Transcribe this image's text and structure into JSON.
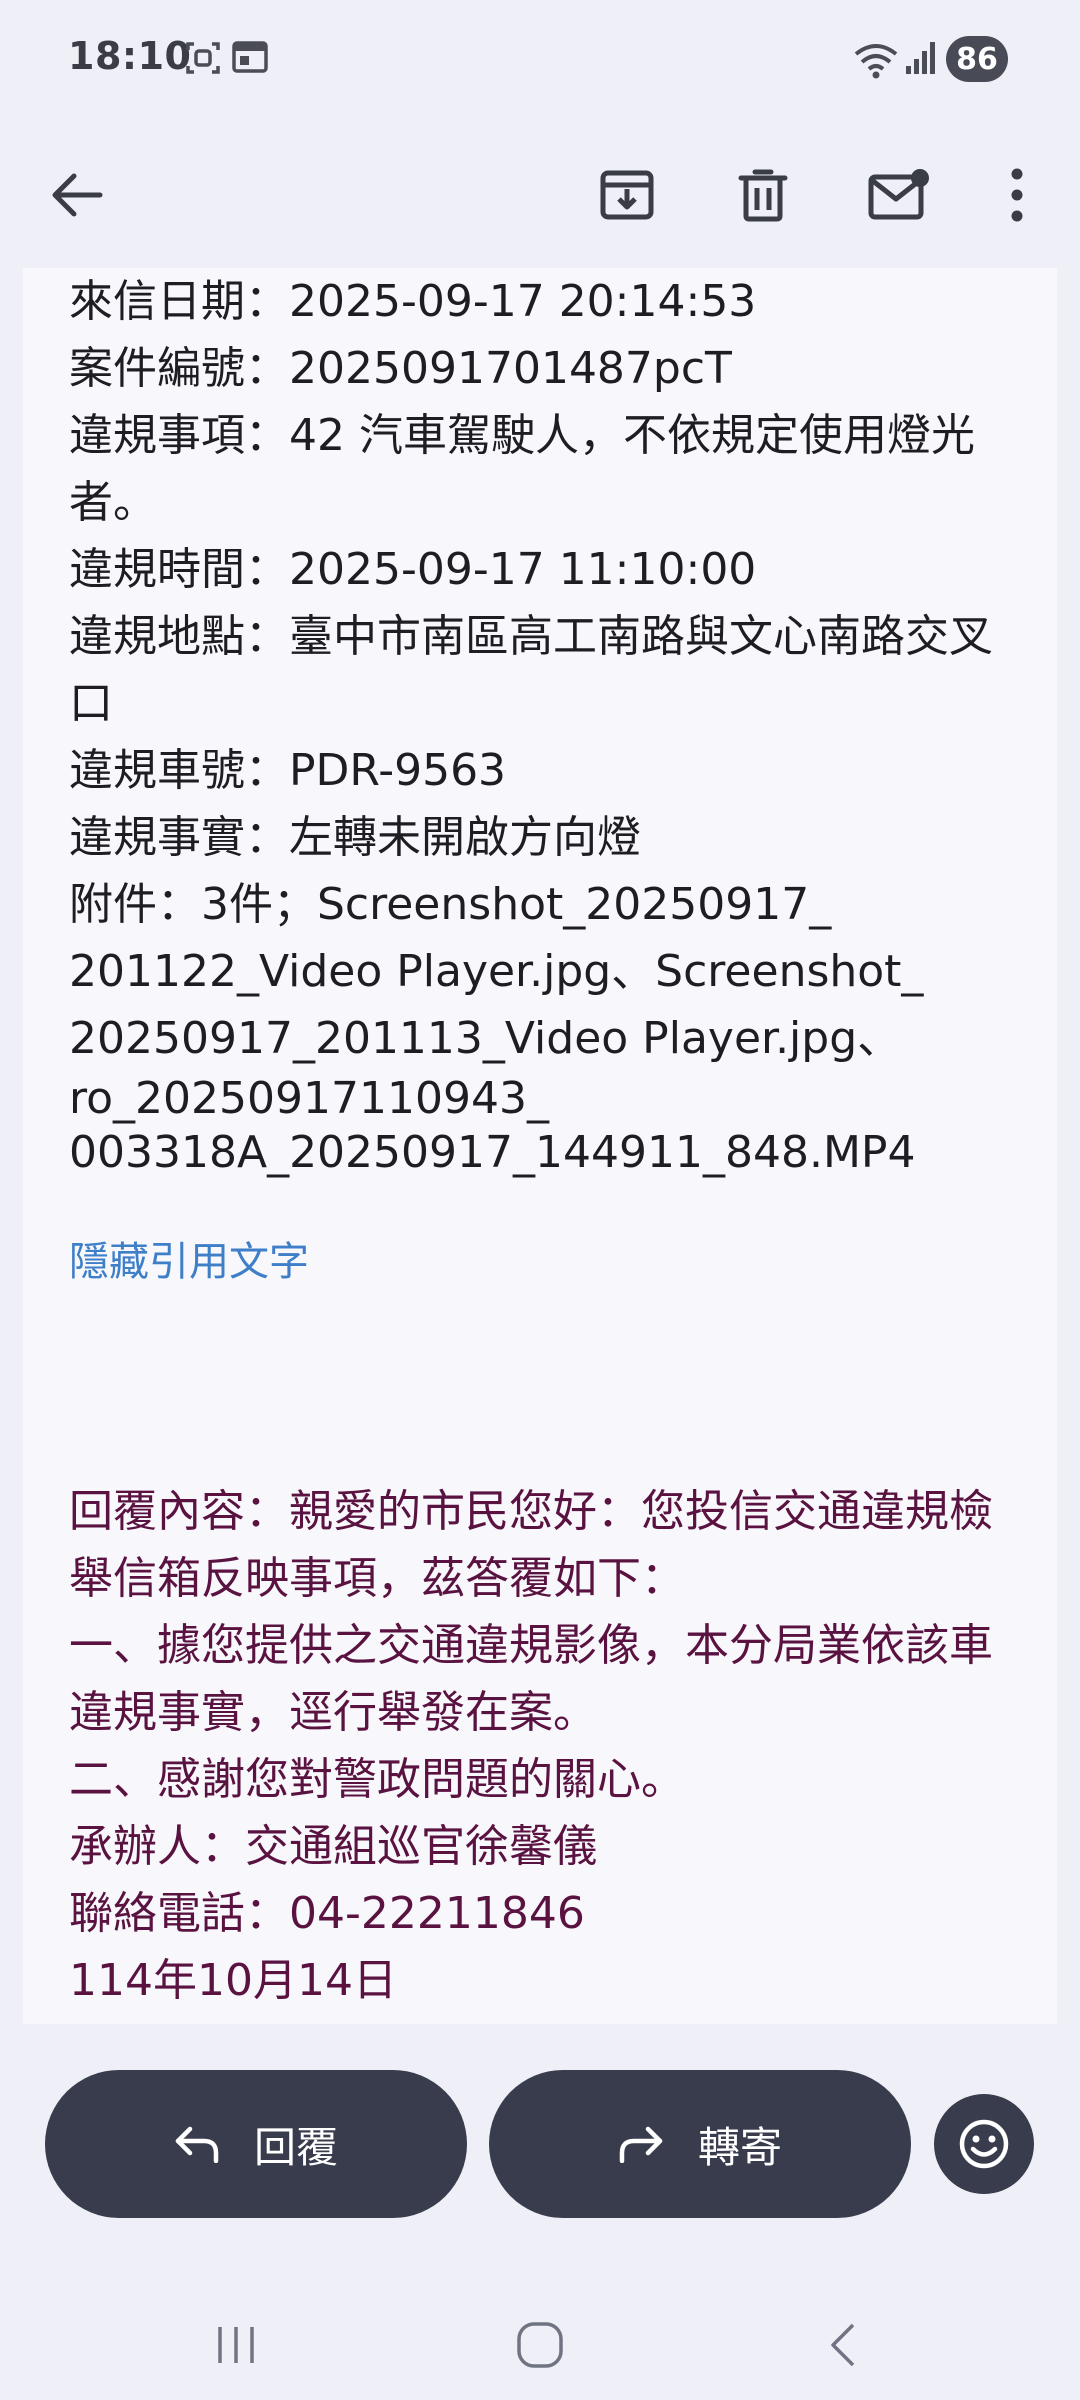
{
  "status_bar": {
    "time": "18:10",
    "battery": "86",
    "icons": [
      "screenshot-icon",
      "calendar-widget-icon",
      "wifi-icon",
      "signal-icon"
    ]
  },
  "toolbar": {
    "icons": [
      "back-arrow-icon",
      "archive-icon",
      "delete-icon",
      "mark-unread-icon",
      "more-vert-icon"
    ]
  },
  "email": {
    "lines": [
      "來信日期：2025-09-17 20:14:53",
      "案件編號：2025091701487pcT",
      "違規事項：42 汽車駕駛人，不依規定使用燈光",
      "者。",
      "違規時間：2025-09-17 11:10:00",
      "違規地點：臺中市南區高工南路與文心南路交叉",
      "口",
      "違規車號：PDR-9563",
      "違規事實：左轉未開啟方向燈",
      "附件：3件；Screenshot_20250917_",
      "201122_Video Player.jpg、Screenshot_",
      "20250917_201113_Video Player.jpg、",
      "ro_20250917110943_",
      "003318A_20250917_144911_848.MP4"
    ],
    "hide_quoted": "隱藏引用文字",
    "reply_lines": [
      "回覆內容：親愛的市民您好：您投信交通違規檢",
      "舉信箱反映事項，茲答覆如下：",
      "一、據您提供之交通違規影像，本分局業依該車",
      "違規事實，逕行舉發在案。",
      "二、感謝您對警政問題的關心。",
      "承辦人：交通組巡官徐馨儀",
      "聯絡電話：04-22211846",
      "114年10月14日"
    ]
  },
  "actions": {
    "reply_label": "回覆",
    "forward_label": "轉寄"
  },
  "colors": {
    "background": "#eff0f7",
    "card": "#f7f7fc",
    "button": "#383c4d",
    "link": "#3f7fc8",
    "reply_text": "#5a1240"
  }
}
